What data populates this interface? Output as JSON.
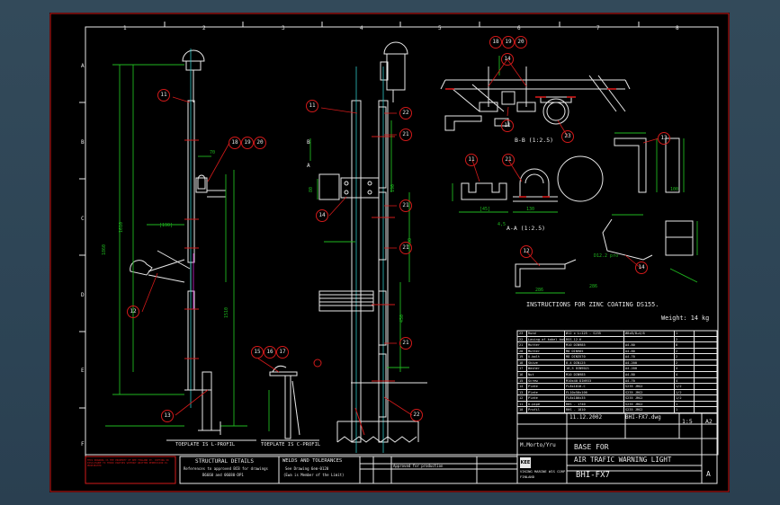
{
  "grid": {
    "columns": [
      "1",
      "2",
      "3",
      "4",
      "5",
      "6",
      "7",
      "8"
    ],
    "rows": [
      "A",
      "B",
      "C",
      "D",
      "E",
      "F"
    ]
  },
  "balloons": {
    "b11a": "11",
    "b18": "18",
    "b19": "19",
    "b20": "20",
    "b12": "12",
    "b13a": "13",
    "b15": "15",
    "b16": "16",
    "b17": "17",
    "b11b": "11",
    "b22a": "22",
    "b21a": "21",
    "b14a": "14",
    "b21b": "21",
    "b21c": "21",
    "b21d": "21",
    "b22b": "22",
    "b18t": "18",
    "b19t": "19",
    "b20t": "20",
    "b14t": "14",
    "b11c": "11",
    "b23": "23",
    "b13b": "13",
    "b11d": "11",
    "b21e": "21",
    "b12b": "12",
    "b14b": "14"
  },
  "view_labels": {
    "section_bb": "B-B (1:2.5)",
    "section_aa": "A-A (1:2.5)",
    "toeplate_l": "TOEPLATE IS L-PROFIL",
    "toeplate_c": "TOEPLATE IS C-PROFIL"
  },
  "dims": {
    "d1": "1610",
    "d2": "1860",
    "d3": "1510",
    "d4": "190",
    "d5": "500",
    "d6": "100",
    "d7": "D12.2 pro",
    "d8": "286",
    "d9": "4,5",
    "d10": "9.5"
  },
  "notes": {
    "zinc": "INSTRUCTIONS FOR ZINC COATING DS155.",
    "weight": "Weight:  14 kg"
  },
  "bom": [
    {
      "pos": "23",
      "name": "Rund",
      "spec": "Ø12 x L=125 - S235",
      "std": "Ø8x8/8+4/8",
      "qty": "1"
    },
    {
      "pos": "22",
      "name": "Lasing af kabel bakke",
      "spec": "RSS 12-K",
      "std": "",
      "qty": "2"
    },
    {
      "pos": "21",
      "name": "Mutter",
      "spec": "M10 DIN985",
      "std": "A4-80",
      "qty": "8"
    },
    {
      "pos": "20",
      "name": "Mutter",
      "spec": "M8 DIN985",
      "std": "A4-80",
      "qty": "2"
    },
    {
      "pos": "19",
      "name": "U-bolt",
      "spec": "M8 DIN3570",
      "std": "A4-70",
      "qty": "2"
    },
    {
      "pos": "18",
      "name": "Skive",
      "spec": "8.4 DIN125",
      "std": "A4-200",
      "qty": "2"
    },
    {
      "pos": "17",
      "name": "Washer",
      "spec": "10,5 DIN9021",
      "std": "A4-200",
      "qty": "4"
    },
    {
      "pos": "16",
      "name": "Nut",
      "spec": "M10 DIN985",
      "std": "A4-80",
      "qty": "4"
    },
    {
      "pos": "15",
      "name": "Screw",
      "spec": "M10x40 DIN933",
      "std": "A4-70",
      "qty": "4"
    },
    {
      "pos": "14",
      "name": "Plate",
      "spec": "FL8x1810-C",
      "std": "S235 JRG2",
      "qty": "1/2"
    },
    {
      "pos": "13",
      "name": "Plate",
      "spec": "FL10x50x100",
      "std": "S235 JRG2",
      "qty": "1/2"
    },
    {
      "pos": "12",
      "name": "Plate",
      "spec": "FL8x186x35",
      "std": "S235 JRG2",
      "qty": "1/2"
    },
    {
      "pos": "11",
      "name": "U-pipe",
      "spec": "RHS - 1740",
      "std": "S235 JRG2",
      "qty": "1"
    },
    {
      "pos": "10",
      "name": "Profil",
      "spec": "RHS - 1810",
      "std": "S235 JRG2",
      "qty": "1"
    }
  ],
  "title_block": {
    "date": "11.12.2002",
    "file": "BHI-FX7.dwg",
    "scale": "1:5",
    "sheet_size": "A2",
    "drawn_by": "M.Morto/Yru",
    "title_line1": "BASE FOR",
    "title_line2": "AIR TRAFIC WARNING LIGHT",
    "drawing_no": "BHI-FX7",
    "rev": "A",
    "company": "VIKING MARINE WIS CORP",
    "company_sub": "FINLAND",
    "logo_text": "KEE",
    "rev_text": "Approved for production"
  },
  "bottom_notes": {
    "struct_title": "STRUCTURAL DETAILS",
    "struct_l1": "References to approved BCB for drawings",
    "struct_l2": "B6660 and 06680-DP1",
    "welds_title": "WELDS AND TOLERANCES",
    "welds_l1": "See Drawing     6em-0120",
    "welds_l2": "(Ewa is Member of the Limit)",
    "disclaimer": "THIS DRAWING IS THE PROPERTY OF KEE FINLAND OY. COPYING OR DISCLOSURE TO THIRD PARTIES WITHOUT WRITTEN PERMISSION IS PROHIBITED"
  },
  "colors": {
    "background": "#2c4354",
    "sheet": "#000000",
    "frame": "#d21a1a",
    "lines": "#e8e8e8",
    "dims": "#1fb81f",
    "center": "#2ec4c4"
  }
}
